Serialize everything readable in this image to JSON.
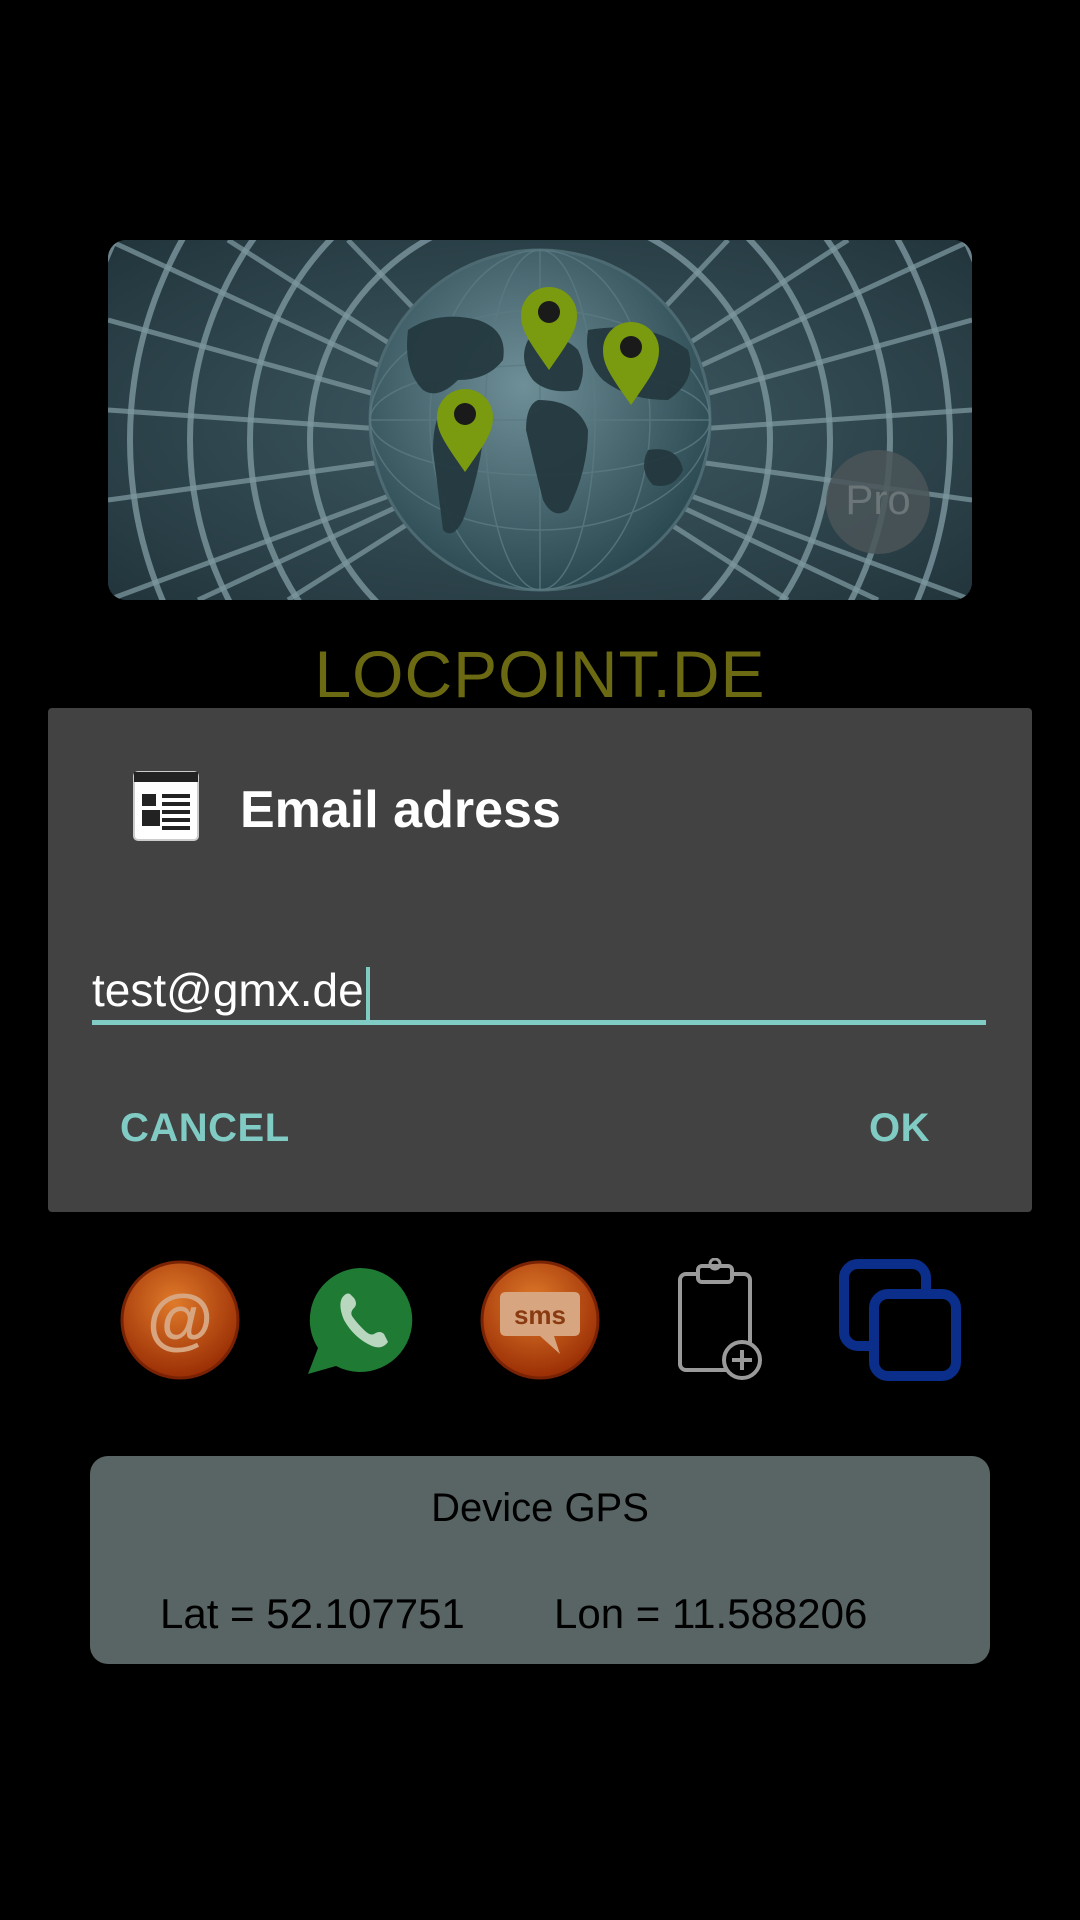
{
  "banner": {
    "badge_label": "Pro"
  },
  "app": {
    "site_name": "LOCPOINT.DE"
  },
  "dialog": {
    "title": "Email adress",
    "email_value": "test@gmx.de",
    "cancel_label": "CANCEL",
    "ok_label": "OK",
    "icon": "contact-card-icon"
  },
  "share_icons": [
    {
      "name": "email-share-icon",
      "label": "@"
    },
    {
      "name": "whatsapp-share-icon"
    },
    {
      "name": "sms-share-icon",
      "label": "sms"
    },
    {
      "name": "clipboard-add-icon"
    },
    {
      "name": "copy-icon"
    }
  ],
  "gps": {
    "title": "Device GPS",
    "lat_text": "Lat = 52.107751",
    "lon_text": "Lon = 11.588206"
  },
  "colors": {
    "accent": "#80cbc4",
    "dialog_bg": "#424242",
    "logo_text": "#6b6a12",
    "gps_panel": "#596565",
    "pin_green": "#7a9a10",
    "email_orange": "#c0460a",
    "whatsapp_green": "#1f7a33",
    "copy_blue": "#0a2e8a"
  }
}
